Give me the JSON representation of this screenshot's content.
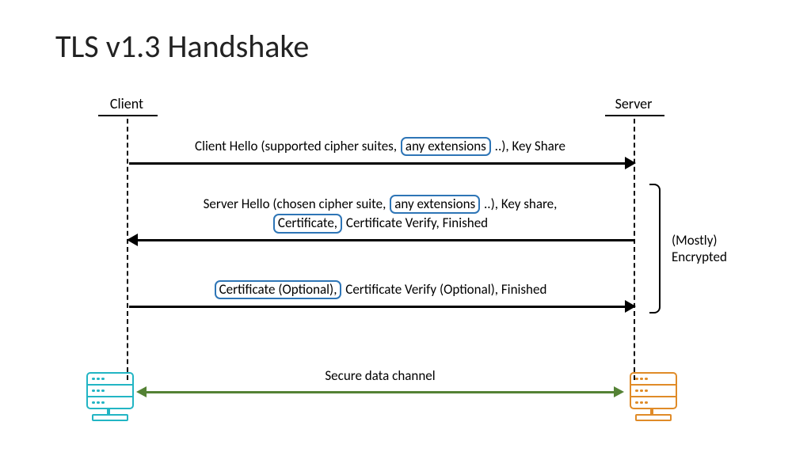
{
  "title": "TLS v1.3 Handshake",
  "lifelines": {
    "client": "Client",
    "server": "Server"
  },
  "messages": {
    "m1": {
      "prefix": "Client Hello (supported cipher suites, ",
      "boxed1": "any extensions",
      "suffix": " ..), Key Share"
    },
    "m2": {
      "line1_prefix": "Server Hello (chosen cipher suite, ",
      "line1_boxed": "any extensions",
      "line1_suffix": " ..), Key share,",
      "line2_boxed": "Certificate,",
      "line2_suffix": " Certificate Verify, Finished"
    },
    "m3": {
      "boxed": "Certificate (Optional),",
      "suffix": " Certificate Verify (Optional), Finished"
    },
    "secure": "Secure data channel"
  },
  "annotation": "(Mostly) Encrypted",
  "colors": {
    "client_icon": "#22b5c4",
    "server_icon": "#e08b28",
    "box_border": "#2e75b6",
    "green_arrow": "#548235"
  }
}
